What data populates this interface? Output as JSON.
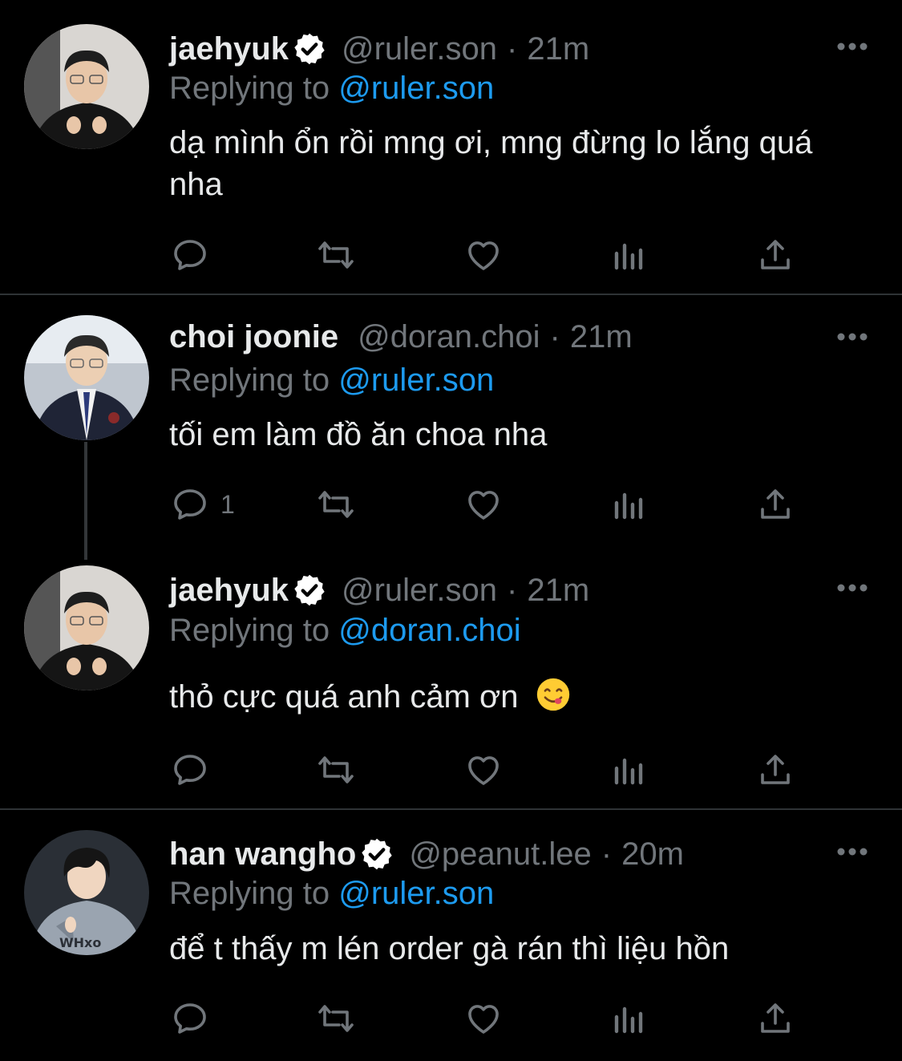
{
  "tweets": [
    {
      "name": "jaehyuk",
      "verified": true,
      "handle": "@ruler.son",
      "time": "21m",
      "reply_prefix": "Replying to",
      "reply_to": "@ruler.son",
      "text": "dạ mình ổn rồi mng ơi, mng đừng lo lắng quá nha",
      "reply_count": ""
    },
    {
      "name": "choi joonie",
      "verified": false,
      "handle": "@doran.choi",
      "time": "21m",
      "reply_prefix": "Replying to",
      "reply_to": "@ruler.son",
      "text": "tối em làm đồ ăn choa nha",
      "reply_count": "1"
    },
    {
      "name": "jaehyuk",
      "verified": true,
      "handle": "@ruler.son",
      "time": "21m",
      "reply_prefix": "Replying to",
      "reply_to": "@doran.choi",
      "text": "thỏ cực quá anh cảm ơn",
      "emoji": "face-savoring-food-emoji",
      "reply_count": ""
    },
    {
      "name": "han wangho",
      "verified": true,
      "handle": "@peanut.lee",
      "time": "20m",
      "reply_prefix": "Replying to",
      "reply_to": "@ruler.son",
      "text": "để t thấy m lén order gà rán thì liệu hồn",
      "reply_count": ""
    }
  ],
  "icons": {
    "reply": "reply-icon",
    "retweet": "retweet-icon",
    "like": "like-icon",
    "views": "views-icon",
    "share": "share-icon",
    "more": "more-icon",
    "verified": "verified-badge-icon"
  },
  "colors": {
    "background": "#000000",
    "text": "#e7e9ea",
    "secondary": "#71767b",
    "link": "#1d9bf0",
    "divider": "#2f3336"
  }
}
